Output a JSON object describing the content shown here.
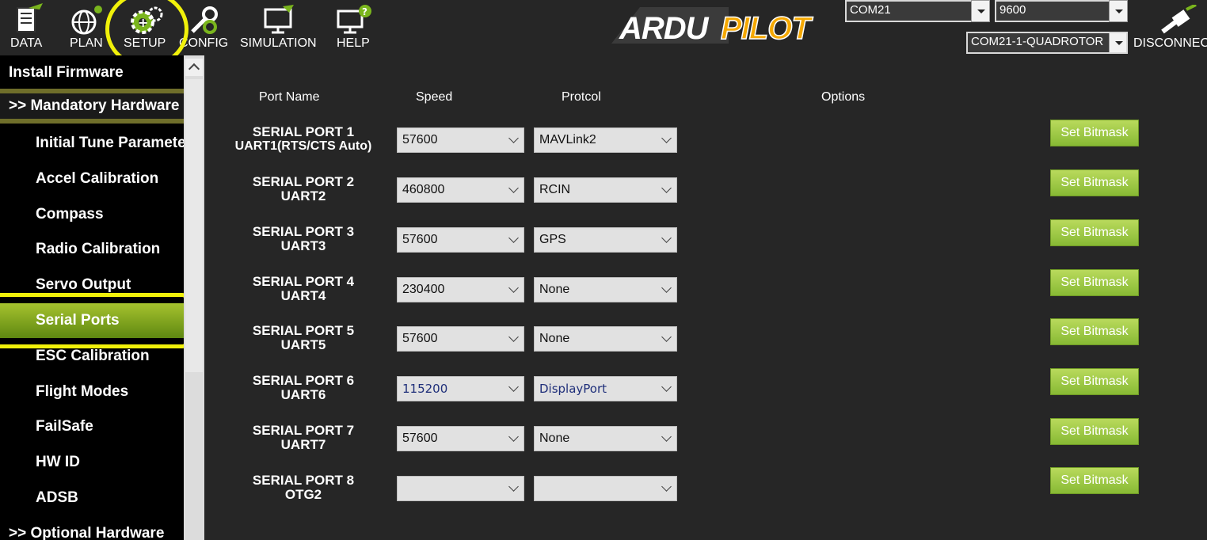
{
  "toolbar": {
    "buttons": [
      {
        "label": "DATA",
        "icon": "data-icon"
      },
      {
        "label": "PLAN",
        "icon": "globe-icon"
      },
      {
        "label": "SETUP",
        "icon": "gear-icon"
      },
      {
        "label": "CONFIG",
        "icon": "wrench-icon"
      },
      {
        "label": "SIMULATION",
        "icon": "monitor-icon"
      },
      {
        "label": "HELP",
        "icon": "help-icon"
      }
    ],
    "logo_text": "ARDUPILOT",
    "port_select": "COM21",
    "baud_select": "9600",
    "link_select": "COM21-1-QUADROTOR",
    "disconnect_label": "DISCONNECT",
    "highlight_color": "#f1f10a"
  },
  "sidebar": {
    "items": [
      {
        "label": "Install Firmware",
        "kind": "top"
      },
      {
        "label": ">> Mandatory Hardware",
        "kind": "section"
      },
      {
        "label": "Initial Tune Parameters",
        "kind": "sub"
      },
      {
        "label": "Accel Calibration",
        "kind": "sub"
      },
      {
        "label": "Compass",
        "kind": "sub"
      },
      {
        "label": "Radio Calibration",
        "kind": "sub"
      },
      {
        "label": "Servo Output",
        "kind": "sub"
      },
      {
        "label": "Serial Ports",
        "kind": "sub",
        "selected": true
      },
      {
        "label": "ESC Calibration",
        "kind": "sub"
      },
      {
        "label": "Flight Modes",
        "kind": "sub"
      },
      {
        "label": "FailSafe",
        "kind": "sub"
      },
      {
        "label": "HW ID",
        "kind": "sub"
      },
      {
        "label": "ADSB",
        "kind": "sub"
      },
      {
        "label": ">> Optional Hardware",
        "kind": "top"
      }
    ]
  },
  "table": {
    "headers": {
      "port_name": "Port Name",
      "speed": "Speed",
      "protocol": "Protcol",
      "options": "Options"
    },
    "bitmask_label": "Set Bitmask",
    "rows": [
      {
        "name_line1": "SERIAL PORT 1",
        "name_line2": "UART1(RTS/CTS Auto)",
        "speed": "57600",
        "protocol": "MAVLink2"
      },
      {
        "name_line1": "SERIAL PORT 2",
        "name_line2": "UART2",
        "speed": "460800",
        "protocol": "RCIN"
      },
      {
        "name_line1": "SERIAL PORT 3",
        "name_line2": "UART3",
        "speed": "57600",
        "protocol": "GPS"
      },
      {
        "name_line1": "SERIAL PORT 4",
        "name_line2": "UART4",
        "speed": "230400",
        "protocol": "None"
      },
      {
        "name_line1": "SERIAL PORT 5",
        "name_line2": "UART5",
        "speed": "57600",
        "protocol": "None"
      },
      {
        "name_line1": "SERIAL PORT 6",
        "name_line2": "UART6",
        "speed": "115200",
        "protocol": "DisplayPort"
      },
      {
        "name_line1": "SERIAL PORT 7",
        "name_line2": "UART7",
        "speed": "57600",
        "protocol": "None"
      },
      {
        "name_line1": "SERIAL PORT 8",
        "name_line2": "OTG2",
        "speed": "",
        "protocol": ""
      }
    ]
  }
}
